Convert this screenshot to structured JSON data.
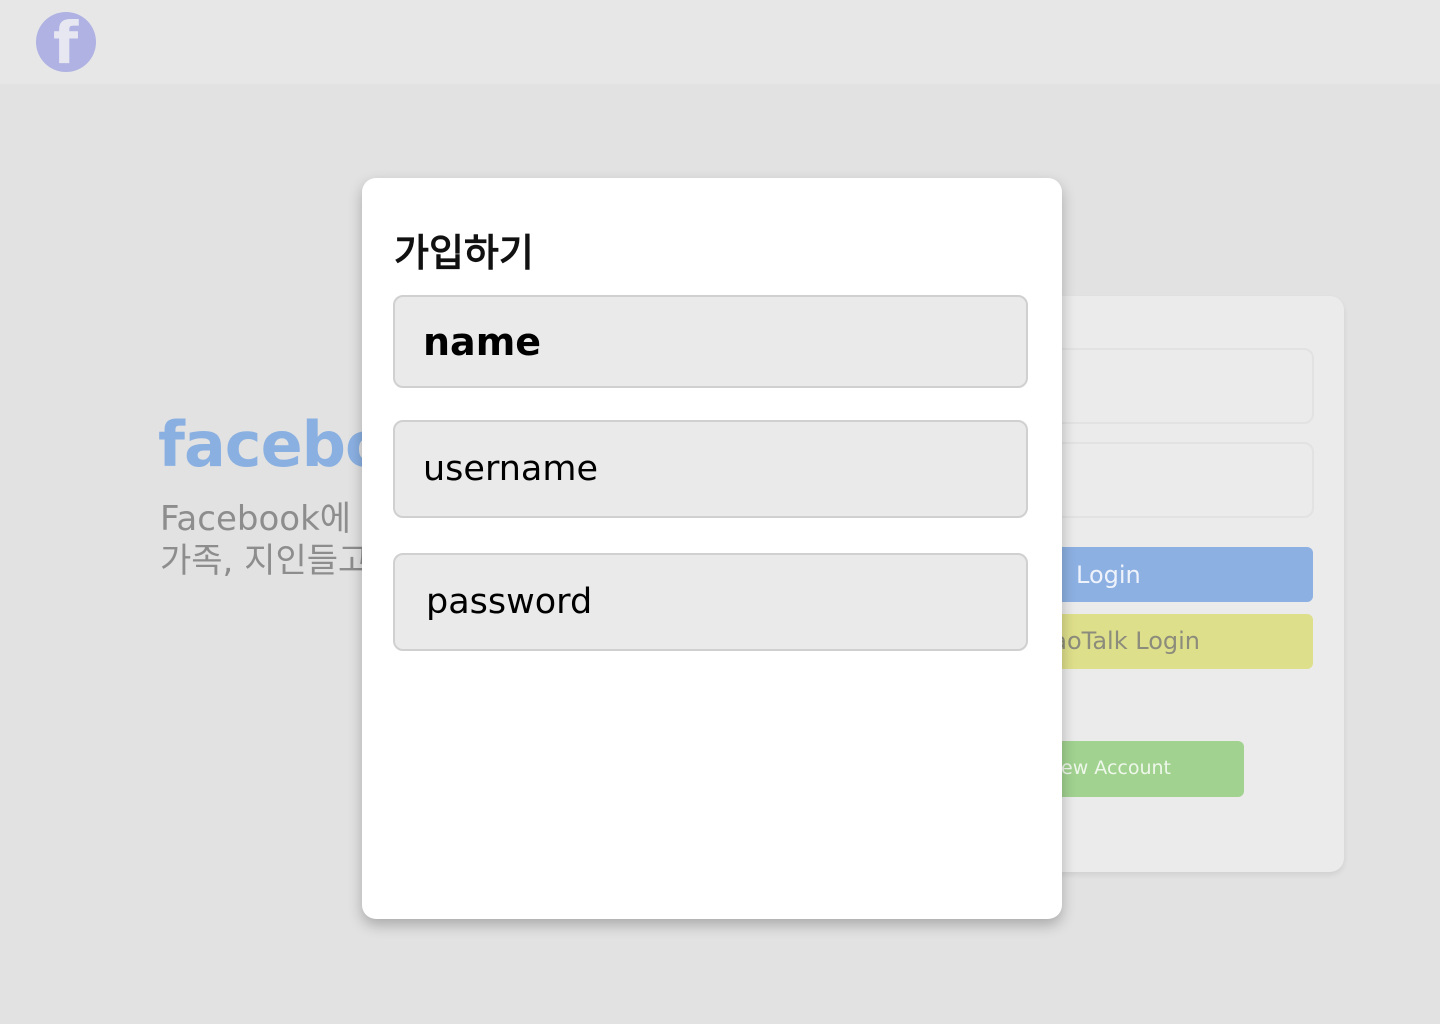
{
  "background": {
    "logo_icon": "facebook-logo-icon",
    "logo_glyph": "f",
    "brand_text": "facebo",
    "tagline_line1": "Facebook에",
    "tagline_line2": "가족, 지인들고",
    "login_card": {
      "login_label": "Login",
      "kakao_label": "aoTalk Login",
      "new_account_label": "ew Account"
    },
    "colors": {
      "logo": "#afb2e2",
      "brand": "#8ab0e2",
      "login_button": "#8cb0e2",
      "kakao_button": "#dedf8b",
      "new_account_button": "#a1d290"
    }
  },
  "modal": {
    "title": "가입하기",
    "fields": {
      "name_placeholder": "name",
      "username_placeholder": "username",
      "password_placeholder": "password"
    }
  }
}
